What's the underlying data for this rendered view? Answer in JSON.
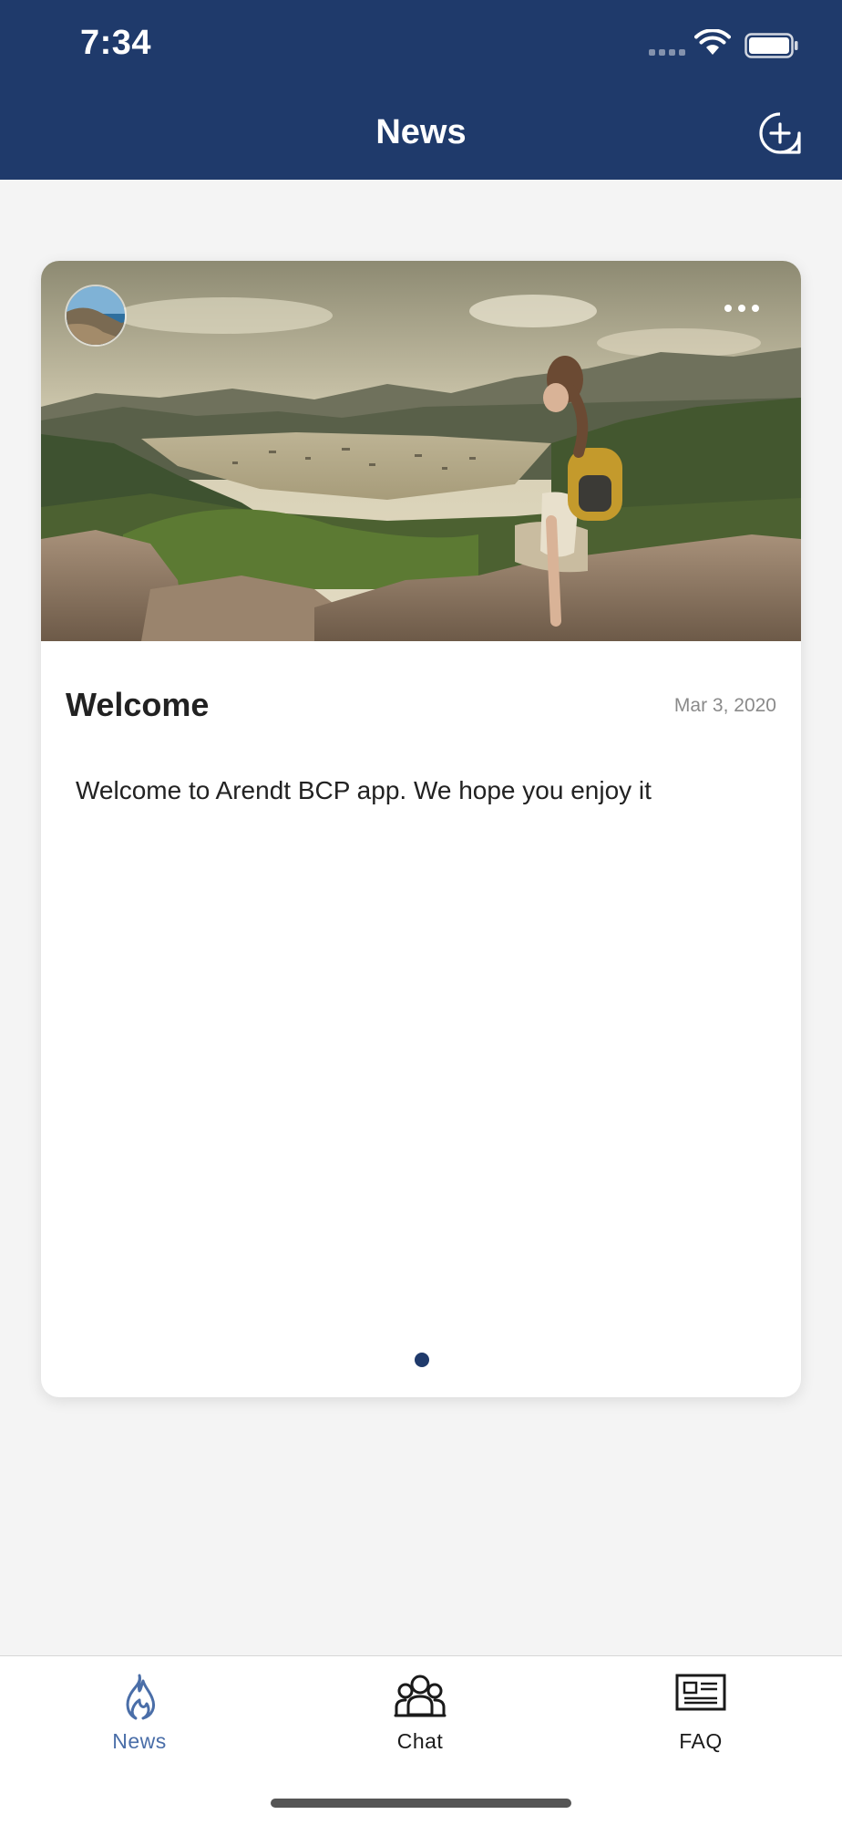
{
  "status_bar": {
    "time": "7:34"
  },
  "header": {
    "title": "News",
    "add_icon": "add-chat-icon",
    "background_color": "#1f3a6b"
  },
  "post": {
    "title": "Welcome",
    "date": "Mar 3, 2020",
    "body": "Welcome to Arendt BCP app. We hope you enjoy it",
    "more_icon": "more-horizontal-icon",
    "page_count": 1,
    "current_page": 1
  },
  "tabbar": {
    "items": [
      {
        "label": "News",
        "icon": "flame-icon",
        "active": true
      },
      {
        "label": "Chat",
        "icon": "group-icon",
        "active": false
      },
      {
        "label": "FAQ",
        "icon": "newspaper-icon",
        "active": false
      }
    ],
    "active_color": "#4a6ea8"
  }
}
